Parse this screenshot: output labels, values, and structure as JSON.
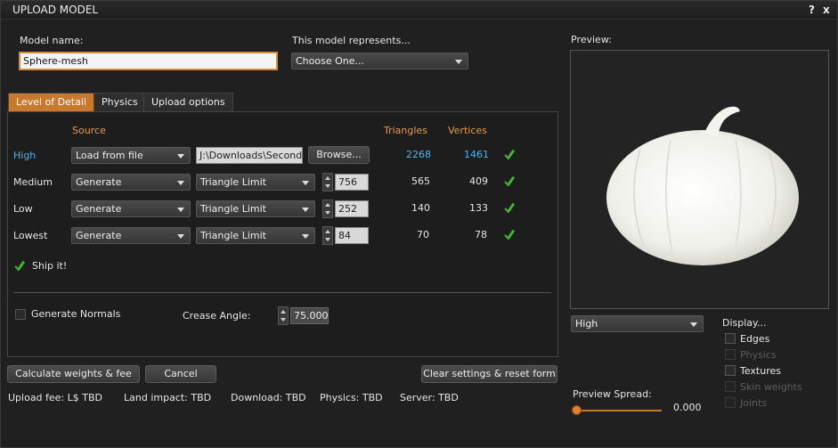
{
  "window": {
    "title": "UPLOAD MODEL",
    "help_icon": "?",
    "close_icon": "x"
  },
  "model_name": {
    "label": "Model name:",
    "value": "Sphere-mesh"
  },
  "represents": {
    "label": "This model represents...",
    "value": "Choose One..."
  },
  "tabs": [
    {
      "label": "Level of Detail",
      "active": true
    },
    {
      "label": "Physics",
      "active": false
    },
    {
      "label": "Upload options",
      "active": false
    }
  ],
  "lod": {
    "headers": {
      "source": "Source",
      "triangles": "Triangles",
      "vertices": "Vertices"
    },
    "rows": [
      {
        "level": "High",
        "source": "Load from file",
        "file": "J:\\Downloads\\Second",
        "action": "Browse...",
        "triangles": "2268",
        "vertices": "1461"
      },
      {
        "level": "Medium",
        "source": "Generate",
        "mode": "Triangle Limit",
        "limit": "756",
        "triangles": "565",
        "vertices": "409"
      },
      {
        "level": "Low",
        "source": "Generate",
        "mode": "Triangle Limit",
        "limit": "252",
        "triangles": "140",
        "vertices": "133"
      },
      {
        "level": "Lowest",
        "source": "Generate",
        "mode": "Triangle Limit",
        "limit": "84",
        "triangles": "70",
        "vertices": "78"
      }
    ],
    "status": "Ship it!"
  },
  "normals": {
    "label": "Generate Normals",
    "crease_label": "Crease Angle:",
    "crease_value": "75.000"
  },
  "buttons": {
    "calculate": "Calculate weights & fee",
    "cancel": "Cancel",
    "reset": "Clear settings & reset form"
  },
  "status_bar": {
    "upload_fee": "Upload fee: L$ TBD",
    "land_impact": "Land impact: TBD",
    "download": "Download: TBD",
    "physics": "Physics: TBD",
    "server": "Server: TBD"
  },
  "preview": {
    "label": "Preview:",
    "lod_value": "High",
    "display_label": "Display...",
    "options": [
      {
        "label": "Edges",
        "enabled": true
      },
      {
        "label": "Physics",
        "enabled": false
      },
      {
        "label": "Textures",
        "enabled": true
      },
      {
        "label": "Skin weights",
        "enabled": false
      },
      {
        "label": "Joints",
        "enabled": false
      }
    ],
    "spread_label": "Preview Spread:",
    "spread_value": "0.000",
    "spread_level": 0
  },
  "colors": {
    "accent": "#c9782f",
    "header": "#e39b4b",
    "link": "#4eb3e8",
    "ok": "#3fb52e"
  }
}
